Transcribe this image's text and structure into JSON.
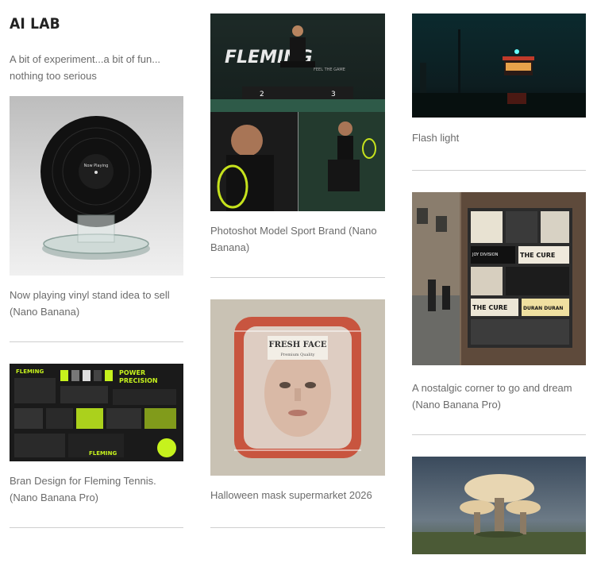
{
  "header": {
    "title": "AI LAB",
    "subtitle": "A bit of experiment...a bit of fun... nothing too serious"
  },
  "cards": [
    {
      "caption": "Now playing vinyl stand idea to sell (Nano Banana)",
      "image_icon": "vinyl-record-image"
    },
    {
      "caption": "Bran Design for Fleming Tennis. (Nano Banana Pro)",
      "image_icon": "brand-design-image"
    },
    {
      "caption": "Photoshot Model Sport Brand (Nano Banana)",
      "image_icon": "tennis-model-image"
    },
    {
      "caption": "Halloween mask supermarket 2026",
      "image_icon": "mask-package-image"
    },
    {
      "caption": "Flash light",
      "image_icon": "night-kiosk-image"
    },
    {
      "caption": "A nostalgic corner to go and dream (Nano Banana Pro)",
      "image_icon": "poster-wall-image"
    },
    {
      "caption": "",
      "image_icon": "mushroom-tree-image"
    }
  ],
  "image_text": {
    "vinyl_label": "Now Playing",
    "fleming_logo": "FLEMING",
    "fleming_tagline": "FEEL THE GAME",
    "power_title": "POWER",
    "precision_title": "PRECISION",
    "podium_left": "2",
    "podium_right": "3",
    "pack_brand": "FRESH FACE",
    "pack_sub": "Premium Quality",
    "poster_cure": "THE CURE",
    "poster_joy": "JOY DIVISION",
    "poster_duran": "DURAN DURAN"
  }
}
